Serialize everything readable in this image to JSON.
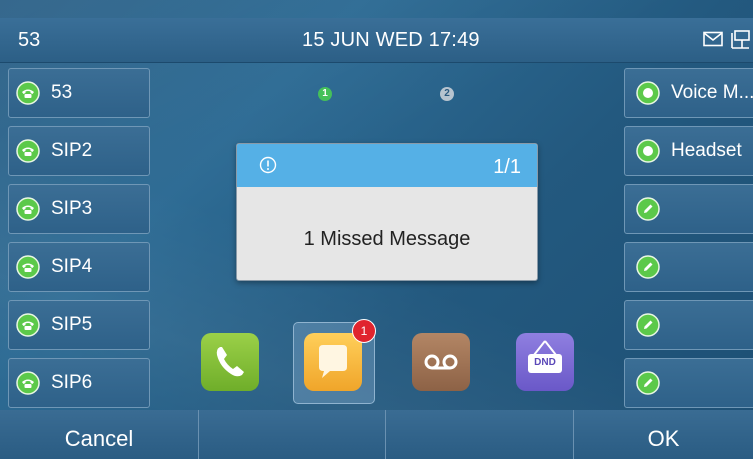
{
  "status_bar": {
    "account": "53",
    "datetime": "15 JUN WED  17:49"
  },
  "left_line_keys": [
    {
      "label": "53"
    },
    {
      "label": "SIP2"
    },
    {
      "label": "SIP3"
    },
    {
      "label": "SIP4"
    },
    {
      "label": "SIP5"
    },
    {
      "label": "SIP6"
    }
  ],
  "right_line_keys": [
    {
      "label": "Voice M..."
    },
    {
      "label": "Headset"
    },
    {
      "label": ""
    },
    {
      "label": ""
    },
    {
      "label": ""
    },
    {
      "label": ""
    }
  ],
  "page_indicator": {
    "pages": [
      "1",
      "2"
    ],
    "active": "1"
  },
  "popup": {
    "counter": "1/1",
    "message": "1 Missed Message"
  },
  "apps": {
    "messages_badge": "1",
    "dnd_label": "DND"
  },
  "soft_keys": {
    "key1": "Cancel",
    "key2": "",
    "key3": "",
    "key4": "OK"
  },
  "colors": {
    "background": "#2a5f86",
    "popup_header": "#55b0e6",
    "line_status_green": "#5cc94a",
    "page_active": "#45c05a",
    "badge_red": "#e0242e"
  }
}
